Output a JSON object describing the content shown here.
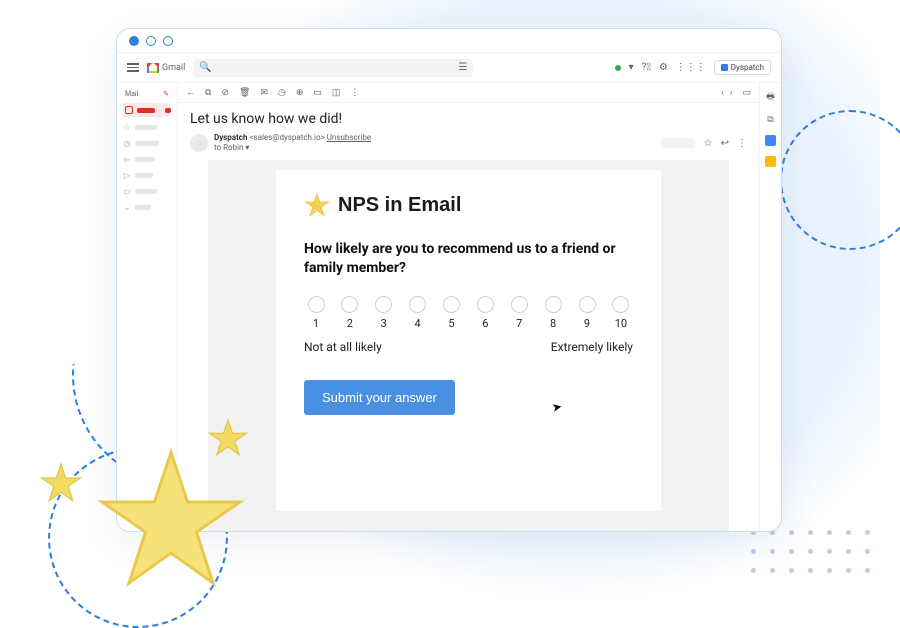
{
  "brand_chip": "Dyspatch",
  "gmail_label": "Gmail",
  "sidebar": {
    "mail_label": "Mail"
  },
  "email": {
    "subject": "Let us know how we did!",
    "sender_name": "Dyspatch",
    "sender_addr": "<sales@dyspatch.io>",
    "unsubscribe": "Unsubscribe",
    "to_line": "to Robin"
  },
  "content": {
    "title": "NPS in Email",
    "question": "How likely are you to recommend us to a friend or family member?",
    "scale": [
      "1",
      "2",
      "3",
      "4",
      "5",
      "6",
      "7",
      "8",
      "9",
      "10"
    ],
    "low_label": "Not at all likely",
    "high_label": "Extremely likely",
    "submit": "Submit your answer"
  }
}
